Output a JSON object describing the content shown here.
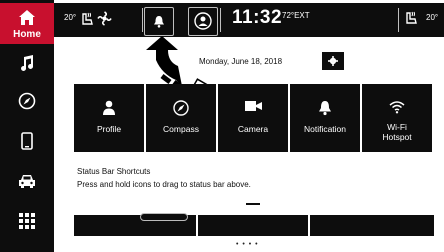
{
  "sidebar": {
    "home_label": "Home",
    "items": [
      {
        "name": "music-icon"
      },
      {
        "name": "compass-icon"
      },
      {
        "name": "phone-icon"
      },
      {
        "name": "car-icon"
      },
      {
        "name": "apps-grid-icon"
      }
    ]
  },
  "statusbar": {
    "left_temp": "20°",
    "time": "11:32",
    "ext_temp": "72°EXT",
    "right_temp": "20°"
  },
  "main": {
    "date": "Monday, June 18, 2018",
    "tiles": [
      {
        "label": "Profile",
        "icon": "profile-icon"
      },
      {
        "label": "Compass",
        "icon": "compass-icon"
      },
      {
        "label": "Camera",
        "icon": "camera-icon"
      },
      {
        "label": "Notification",
        "icon": "bell-icon"
      },
      {
        "label": "Wi-Fi\nHotspot",
        "icon": "wifi-icon"
      }
    ],
    "shortcut_title": "Status Bar Shortcuts",
    "shortcut_hint": "Press and hold icons to drag to status bar above.",
    "page_dots": "• • • •"
  }
}
